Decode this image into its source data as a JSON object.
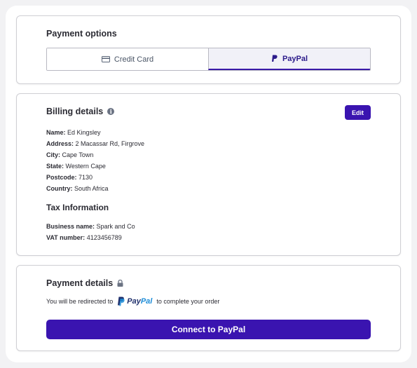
{
  "payment_options": {
    "title": "Payment options",
    "tabs": [
      {
        "label": "Credit Card",
        "icon": "credit-card-icon",
        "active": false
      },
      {
        "label": "PayPal",
        "icon": "paypal-icon",
        "active": true
      }
    ]
  },
  "billing": {
    "title": "Billing details",
    "edit_label": "Edit",
    "fields": [
      {
        "label": "Name:",
        "value": "Ed Kingsley"
      },
      {
        "label": "Address:",
        "value": "2 Macassar Rd, Firgrove"
      },
      {
        "label": "City:",
        "value": "Cape Town"
      },
      {
        "label": "State:",
        "value": "Western Cape"
      },
      {
        "label": "Postcode:",
        "value": "7130"
      },
      {
        "label": "Country:",
        "value": "South Africa"
      }
    ]
  },
  "tax": {
    "title": "Tax Information",
    "fields": [
      {
        "label": "Business name:",
        "value": "Spark and Co"
      },
      {
        "label": "VAT number:",
        "value": "4123456789"
      }
    ]
  },
  "payment_details": {
    "title": "Payment details",
    "redirect_prefix": "You will be redirected to",
    "redirect_brand_pay": "Pay",
    "redirect_brand_pal": "Pal",
    "redirect_suffix": "to complete your order",
    "connect_label": "Connect to PayPal"
  },
  "colors": {
    "accent": "#3a14b0",
    "paypal_dark": "#1f2f6b",
    "paypal_light": "#1d8dd8"
  }
}
